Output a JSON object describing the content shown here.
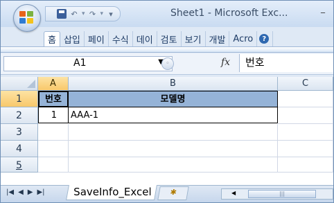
{
  "window": {
    "title": "Sheet1 - Microsoft Exc..."
  },
  "qat": {
    "undo": "↶",
    "redo": "↷",
    "dropdown": "▾"
  },
  "tabs": [
    "홈",
    "삽입",
    "페이",
    "수식",
    "데이",
    "검토",
    "보기",
    "개발",
    "Acro"
  ],
  "formula_bar": {
    "name_box": "A1",
    "fx": "fx",
    "content": "번호"
  },
  "columns": [
    "A",
    "B",
    "C"
  ],
  "rows": [
    "1",
    "2",
    "3",
    "4",
    "5"
  ],
  "cells": {
    "a1": "번호",
    "b1": "모델명",
    "a2": "1",
    "b2": "AAA-1"
  },
  "sheet_tabs": {
    "active": "SaveInfo_Excel"
  },
  "colors": {
    "header_fill": "#95b3d7",
    "selected_header": "#f8c86b"
  }
}
